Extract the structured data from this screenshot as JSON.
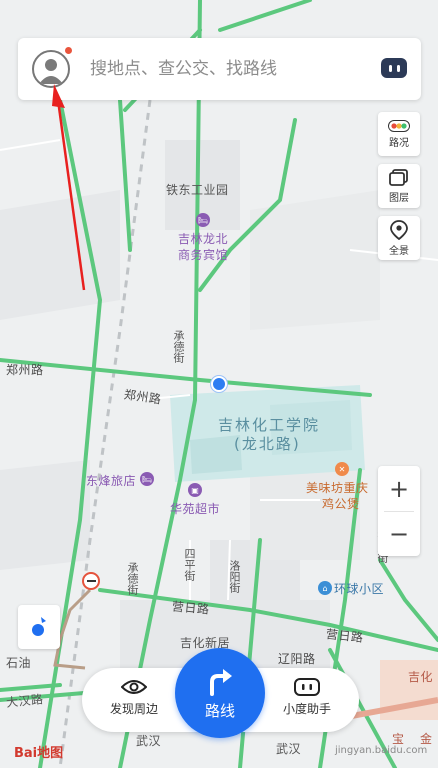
{
  "search": {
    "placeholder": "搜地点、查公交、找路线"
  },
  "tools": {
    "traffic": "路况",
    "layers": "图层",
    "panorama": "全景"
  },
  "zoom": {
    "in": "+",
    "out": "−"
  },
  "bottom": {
    "discover": "发现周边",
    "route": "路线",
    "assistant": "小度助手"
  },
  "map": {
    "industrial_park": "铁东工业园",
    "hotel_line1": "吉林龙北",
    "hotel_line2": "商务宾馆",
    "zhengzhou_road_left": "郑州路",
    "zhengzhou_road_mid": "郑州路",
    "chengde_street_top": "承德街",
    "chengde_street_bottom": "承德街",
    "college_line1": "吉林化工学院",
    "college_line2": "(龙北路)",
    "restaurant_line1": "美味坊重庆",
    "restaurant_line2": "鸡公煲",
    "dongfeng_hotel": "东烽旅店",
    "huayuan_market": "华苑超市",
    "fushun_street": "抚顺街",
    "siping_street": "四平街",
    "luoyang_street": "洛阳街",
    "huanqiu_district": "环球小区",
    "zirui_road_left": "营日路",
    "zirui_road_right": "营日路",
    "jihua_new_residence": "吉化新居",
    "liaoyang_road": "辽阳路",
    "shiyou": "石油",
    "wuhan_road_1": "武汉",
    "wuhan_road_2": "武汉",
    "dayuan_road": "大汉路",
    "jihua_right": "吉化",
    "bao_text": "宝",
    "jin_text": "金"
  },
  "brand": {
    "logo": "Bai地图",
    "watermark": "jingyan.baidu.com"
  },
  "colors": {
    "road_green": "#5cc87e",
    "campus": "#cfe9e9",
    "route_blue": "#1f6ff0",
    "poi_purple": "#8a5bb3",
    "poi_orange": "#f08a4b",
    "arrow_red": "#e8201f"
  }
}
